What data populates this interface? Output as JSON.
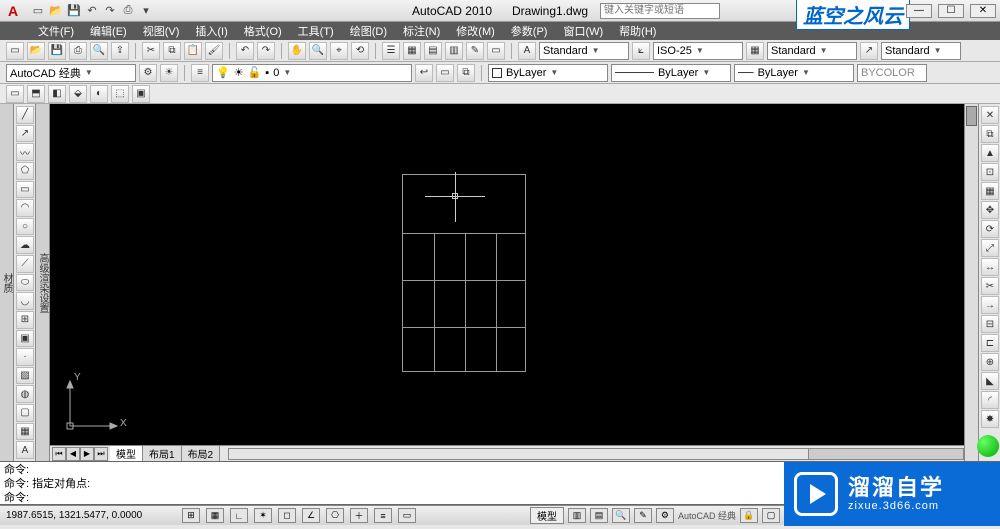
{
  "title": {
    "app": "AutoCAD 2010",
    "doc": "Drawing1.dwg"
  },
  "search_placeholder": "键入关键字或短语",
  "watermark": "蓝空之风云",
  "window_buttons": {
    "min": "—",
    "max": "☐",
    "close": "✕"
  },
  "menu": [
    "文件(F)",
    "编辑(E)",
    "视图(V)",
    "插入(I)",
    "格式(O)",
    "工具(T)",
    "绘图(D)",
    "标注(N)",
    "修改(M)",
    "参数(P)",
    "窗口(W)",
    "帮助(H)"
  ],
  "workspace_selector": "AutoCAD 经典",
  "style_dropdowns": {
    "text_style": "Standard",
    "dim_style": "ISO-25",
    "table_style": "Standard",
    "mleader_style": "Standard"
  },
  "layer_dropdown": "0",
  "linecolor": "ByLayer",
  "linetype": "ByLayer",
  "lineweight": "ByLayer",
  "plotstyle": "BYCOLOR",
  "layout_tabs": {
    "model": "模型",
    "layout1": "布局1",
    "layout2": "布局2"
  },
  "command_lines": [
    "命令:",
    "命令: 指定对角点:",
    "命令:"
  ],
  "status": {
    "coords": "1987.6515, 1321.5477, 0.0000",
    "mode_label": "模型",
    "tray_text": "AutoCAD 经典"
  },
  "ucs": {
    "x": "X",
    "y": "Y"
  },
  "badge": {
    "big": "溜溜自学",
    "small": "zixue.3d66.com"
  }
}
